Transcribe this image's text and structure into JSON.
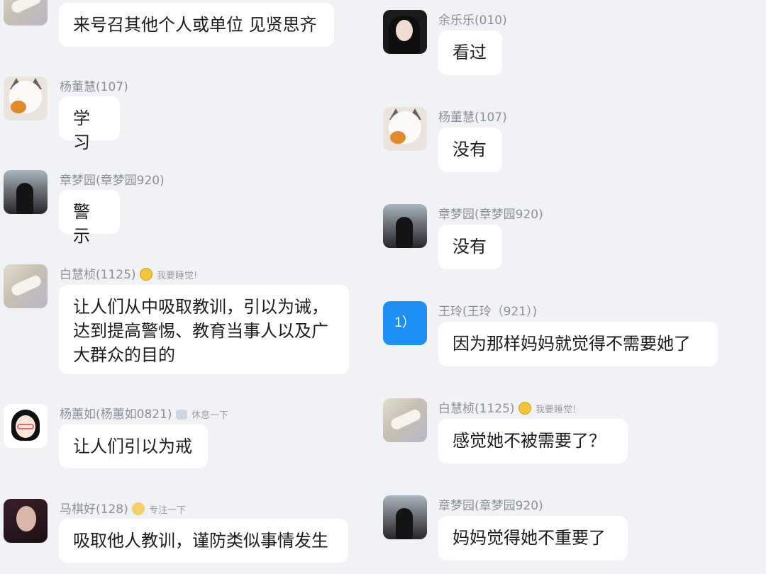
{
  "left": [
    {
      "name": "",
      "text": "来号召其他个人或单位 见贤思齐",
      "avatar": "cat-avatar"
    },
    {
      "name": "杨董慧(107)",
      "text": "学习",
      "avatar": "cat-avatar"
    },
    {
      "name": "章梦园(章梦园920)",
      "text": "警示",
      "avatar": "dusk-avatar"
    },
    {
      "name": "白慧桢(1125)",
      "status": "我要睡觉!",
      "status_icon": "sleepy-emoji-icon",
      "text": "让人们从中吸取教训，引以为诫，\n达到提高警惕、教育当事人以及广\n大群众的目的",
      "avatar": "painting-avatar"
    },
    {
      "name": "杨蕙如(杨蕙如0821)",
      "status": "休息一下",
      "status_icon": "tea-icon",
      "text": "让人们引以为戒",
      "avatar": "cartoon-girl-avatar"
    },
    {
      "name": "马棋好(128)",
      "status": "专注一下",
      "status_icon": "focus-emoji-icon",
      "text": "吸取他人教训，谨防类似事情发生",
      "avatar": "dark-portrait-avatar"
    }
  ],
  "right": [
    {
      "name": "余乐乐(010)",
      "text": "看过",
      "avatar": "portrait-avatar"
    },
    {
      "name": "杨董慧(107)",
      "text": "没有",
      "avatar": "cat-avatar"
    },
    {
      "name": "章梦园(章梦园920)",
      "text": "没有",
      "avatar": "dusk-avatar"
    },
    {
      "name": "王玲(王玲（921）)",
      "text": "因为那样妈妈就觉得不需要她了",
      "avatar": "blue-avatar",
      "avatar_text": "1）"
    },
    {
      "name": "白慧桢(1125)",
      "status": "我要睡觉!",
      "status_icon": "sleepy-emoji-icon",
      "text": "感觉她不被需要了？",
      "avatar": "painting-avatar"
    },
    {
      "name": "章梦园(章梦园920)",
      "text": "妈妈觉得她不重要了",
      "avatar": "dusk-avatar"
    }
  ],
  "colors": {
    "background": "#f1f2f6",
    "bubble": "#ffffff",
    "name": "#8b8f97",
    "blue_avatar": "#1e8ff5"
  }
}
